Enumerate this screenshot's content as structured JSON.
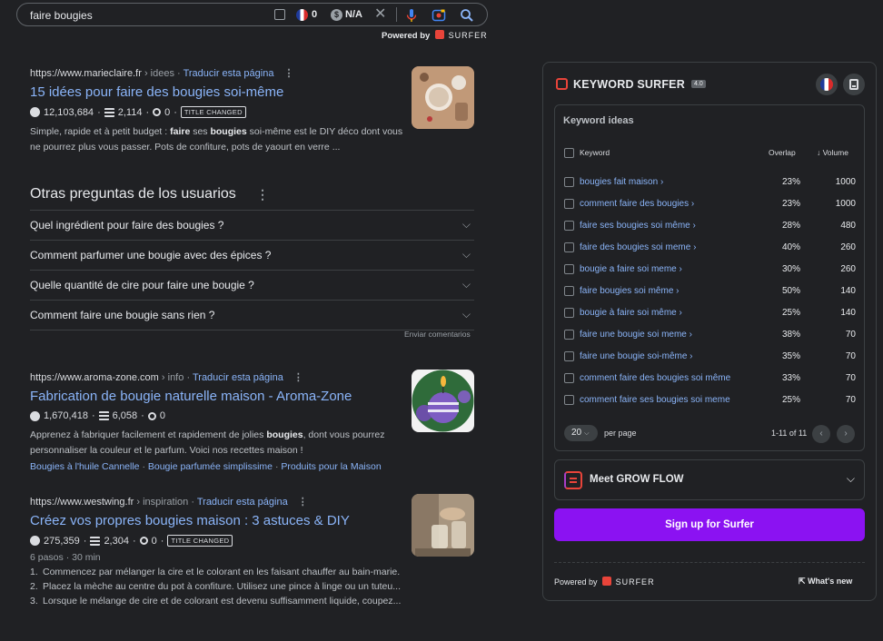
{
  "search": {
    "query": "faire bougies",
    "flag_count": "0",
    "cost": "N/A",
    "powered_by": "Powered by",
    "surfer_label": "SURFER"
  },
  "results": [
    {
      "domain": "https://www.marieclaire.fr",
      "path": "› idees",
      "translate": "Traducir esta página",
      "title": "15 idées pour faire des bougies soi-même",
      "visits": "12,103,684",
      "words": "2,114",
      "keywords": "0",
      "tag": "TITLE CHANGED",
      "snippet_pre": "Simple, rapide et à petit budget : ",
      "snippet_b1": "faire",
      "snippet_mid": " ses ",
      "snippet_b2": "bougies",
      "snippet_post": " soi-même est le DIY déco dont vous ne pourrez plus vous passer. Pots de confiture, pots de yaourt en verre ..."
    },
    {
      "domain": "https://www.aroma-zone.com",
      "path": "› info",
      "translate": "Traducir esta página",
      "title": "Fabrication de bougie naturelle maison - Aroma-Zone",
      "visits": "1,670,418",
      "words": "6,058",
      "keywords": "0",
      "snippet_pre": "Apprenez à fabriquer facilement et rapidement de jolies ",
      "snippet_b1": "bougies",
      "snippet_post": ", dont vous pourrez personnaliser la couleur et le parfum. Voici nos recettes maison !",
      "sublinks": [
        "Bougies à l'huile Cannelle",
        "Bougie parfumée simplissime",
        "Produits pour la Maison"
      ]
    },
    {
      "domain": "https://www.westwing.fr",
      "path": "› inspiration",
      "translate": "Traducir esta página",
      "title": "Créez vos propres bougies maison : 3 astuces & DIY",
      "visits": "275,359",
      "words": "2,304",
      "keywords": "0",
      "tag": "TITLE CHANGED",
      "meta": "6 pasos · 30 min",
      "steps": [
        "Commencez par mélanger la cire et le colorant en les faisant chauffer au bain-marie.",
        "Placez la mèche au centre du pot à confiture. Utilisez une pince à linge ou un tuteu...",
        "Lorsque le mélange de cire et de colorant est devenu suffisamment liquide, coupez..."
      ]
    }
  ],
  "paa": {
    "title": "Otras preguntas de los usuarios",
    "questions": [
      "Quel ingrédient pour faire des bougies ?",
      "Comment parfumer une bougie avec des épices ?",
      "Quelle quantité de cire pour faire une bougie ?",
      "Comment faire une bougie sans rien ?"
    ],
    "feedback": "Enviar comentarios"
  },
  "panel": {
    "title": "KEYWORD SURFER",
    "version": "4.0",
    "kw_heading": "Keyword ideas",
    "col_keyword": "Keyword",
    "col_overlap": "Overlap",
    "col_volume": "↓ Volume",
    "keywords": [
      {
        "kw": "bougies fait maison ›",
        "overlap": "23%",
        "volume": "1000"
      },
      {
        "kw": "comment faire des bougies ›",
        "overlap": "23%",
        "volume": "1000"
      },
      {
        "kw": "faire ses bougies soi même ›",
        "overlap": "28%",
        "volume": "480"
      },
      {
        "kw": "faire des bougies soi meme ›",
        "overlap": "40%",
        "volume": "260"
      },
      {
        "kw": "bougie a faire soi meme ›",
        "overlap": "30%",
        "volume": "260"
      },
      {
        "kw": "faire bougies soi même ›",
        "overlap": "50%",
        "volume": "140"
      },
      {
        "kw": "bougie à faire soi même ›",
        "overlap": "25%",
        "volume": "140"
      },
      {
        "kw": "faire une bougie soi meme ›",
        "overlap": "38%",
        "volume": "70"
      },
      {
        "kw": "faire une bougie soi-même ›",
        "overlap": "35%",
        "volume": "70"
      },
      {
        "kw": "comment faire des bougies soi même",
        "overlap": "33%",
        "volume": "70"
      },
      {
        "kw": "comment faire ses bougies soi meme",
        "overlap": "25%",
        "volume": "70"
      }
    ],
    "per_page_value": "20",
    "per_page_label": "per page",
    "range": "1-11 of 11",
    "grow_label": "Meet GROW FLOW",
    "signup_label": "Sign up for Surfer",
    "powered_by": "Powered by",
    "surfer_label": "SURFER",
    "whats_new": "What's new"
  }
}
